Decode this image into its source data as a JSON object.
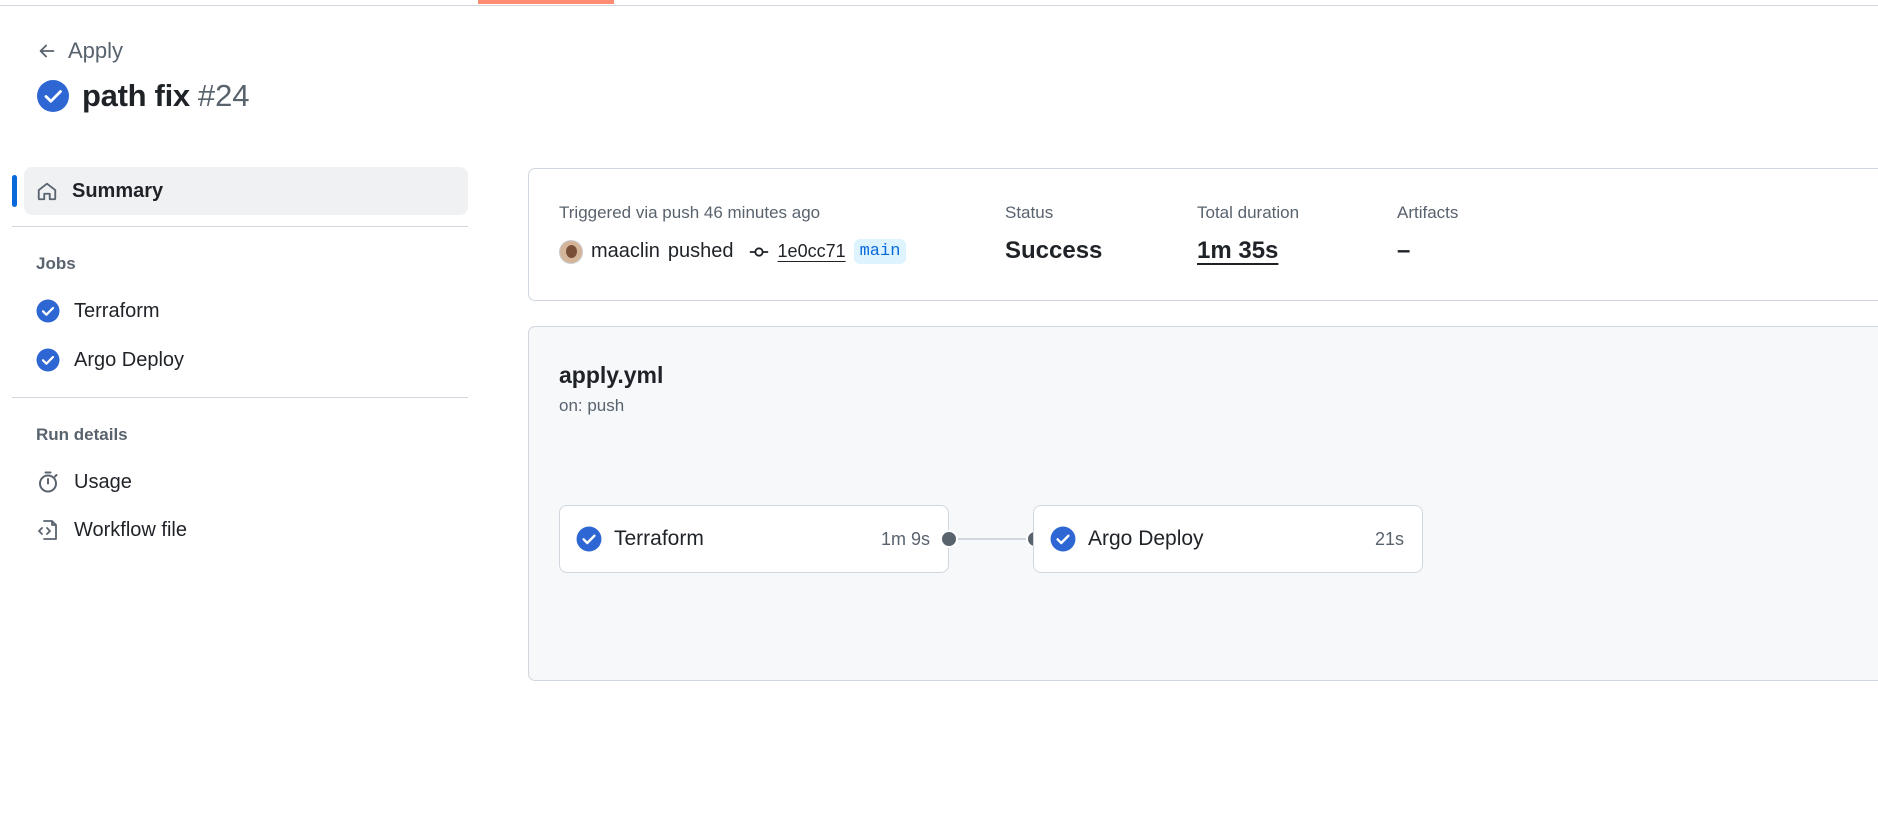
{
  "header": {
    "back_label": "Apply",
    "run_title": "path fix",
    "run_number": "#24"
  },
  "sidebar": {
    "summary_label": "Summary",
    "jobs_heading": "Jobs",
    "jobs": [
      {
        "label": "Terraform"
      },
      {
        "label": "Argo Deploy"
      }
    ],
    "run_details_heading": "Run details",
    "details": [
      {
        "label": "Usage"
      },
      {
        "label": "Workflow file"
      }
    ]
  },
  "summary": {
    "trigger_label": "Triggered via push 46 minutes ago",
    "actor": "maaclin",
    "action": "pushed",
    "commit": "1e0cc71",
    "branch": "main",
    "status_label": "Status",
    "status_value": "Success",
    "duration_label": "Total duration",
    "duration_value": "1m 35s",
    "artifacts_label": "Artifacts",
    "artifacts_value": "–"
  },
  "workflow": {
    "file": "apply.yml",
    "trigger": "on: push",
    "jobs": [
      {
        "name": "Terraform",
        "duration": "1m 9s",
        "status": "success"
      },
      {
        "name": "Argo Deploy",
        "duration": "21s",
        "status": "success"
      }
    ]
  },
  "colors": {
    "success": "#2e67d3",
    "accent": "#0969da",
    "progress": "#fd8c73"
  }
}
